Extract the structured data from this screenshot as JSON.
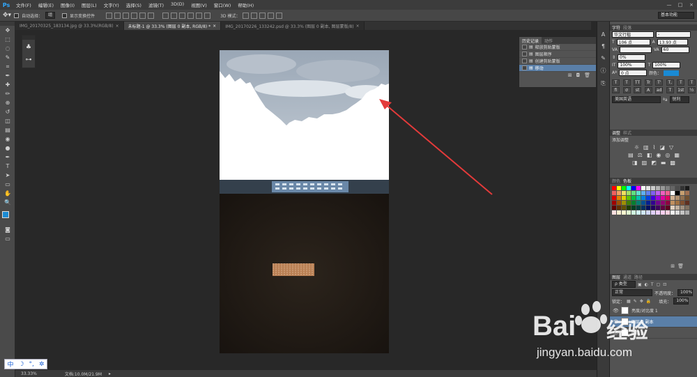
{
  "app": {
    "logo": "Ps"
  },
  "menu": [
    "文件(F)",
    "编辑(E)",
    "图像(I)",
    "图层(L)",
    "文字(Y)",
    "选择(S)",
    "滤镜(T)",
    "3D(D)",
    "视图(V)",
    "窗口(W)",
    "帮助(H)"
  ],
  "window_controls": [
    "—",
    "□",
    "×"
  ],
  "options": {
    "auto_select": "自动选择：",
    "auto_select_target": "组",
    "show_transform": "显示变换控件",
    "mode_3d": "3D 模式：",
    "workspace": "基本功能"
  },
  "tabs": [
    {
      "label": "IMG_20170325_183134.jpg @ 33.3%(RGB/8)",
      "active": false
    },
    {
      "label": "未标题-1 @ 33.3% (图层 0 副本, RGB/8) *",
      "active": true
    },
    {
      "label": "IMG_20170226_133242.psd @ 33.3% (图层 0 副本, 图层蒙版/8)",
      "active": false
    }
  ],
  "tools": [
    "移动",
    "矩形选框",
    "套索",
    "快速选择",
    "裁剪",
    "吸管",
    "污点修复",
    "画笔",
    "仿制图章",
    "历史记录画笔",
    "橡皮擦",
    "渐变",
    "模糊",
    "减淡",
    "钢笔",
    "文字",
    "路径选择",
    "矩形",
    "抓手",
    "缩放"
  ],
  "tool_icons": [
    "move-icon",
    "marquee-icon",
    "lasso-icon",
    "quick-select-icon",
    "crop-icon",
    "eyedropper-icon",
    "healing-icon",
    "brush-icon",
    "stamp-icon",
    "history-brush-icon",
    "eraser-icon",
    "gradient-icon",
    "blur-icon",
    "dodge-icon",
    "pen-icon",
    "type-icon",
    "path-select-icon",
    "rectangle-icon",
    "hand-icon",
    "zoom-icon"
  ],
  "tool_glyphs": [
    "✥",
    "⬚",
    "◌",
    "✎",
    "⌗",
    "✒",
    "✚",
    "✏",
    "⊕",
    "↺",
    "◫",
    "▤",
    "◉",
    "●",
    "✒",
    "T",
    "➤",
    "▭",
    "✋",
    "🔍"
  ],
  "colors": {
    "foreground": "#1a8ad4",
    "background": "#ffffff",
    "accent": "#5a7fa8",
    "arrow": "#e33a3a"
  },
  "history": {
    "tabs": [
      "历史记录",
      "动作"
    ],
    "items": [
      {
        "label": "释放剪贴蒙版",
        "active": false
      },
      {
        "label": "图层顺序",
        "active": false
      },
      {
        "label": "创建剪贴蒙版",
        "active": false
      },
      {
        "label": "移动",
        "active": true
      }
    ]
  },
  "character": {
    "tab": "字符",
    "tab2": "段落",
    "font_family": "华文行楷",
    "font_style": "-",
    "size": "106 点",
    "leading": "13.93 点",
    "tracking_label": "VA",
    "tracking": "60",
    "scale_pct": "0%",
    "vertical_scale": "100%",
    "horizontal_scale": "100%",
    "baseline": "0 点",
    "color_label": "颜色：",
    "style_buttons": [
      "T",
      "T",
      "TT",
      "Tr",
      "T'",
      "T,",
      "T",
      "T"
    ],
    "ligature_buttons": [
      "fi",
      "σ",
      "st",
      "A",
      "ad",
      "T",
      "1st",
      "½"
    ],
    "language": "美国英语",
    "aa_label": "ªa",
    "antialias": "锐利"
  },
  "adjustments": {
    "tabs": [
      "调整",
      "样式"
    ],
    "title": "添加调整"
  },
  "swatches": {
    "tabs": [
      "颜色",
      "色板"
    ]
  },
  "layers": {
    "tabs": [
      "图层",
      "通道",
      "路径"
    ],
    "kind": "ρ 类型",
    "blend": "正常",
    "opacity_label": "不透明度：",
    "opacity": "100%",
    "lock_label": "锁定：",
    "fill_label": "填充：",
    "fill": "100%",
    "items": [
      {
        "label": "亮度/对比度 1",
        "active": false
      },
      {
        "label": "图层 0 副本",
        "active": true
      },
      {
        "label": "图层 0",
        "active": false
      }
    ]
  },
  "status": {
    "zoom": "33.33%",
    "doc": "文档:10.0M/21.9M"
  },
  "ime": [
    "中",
    "☽",
    "°,",
    "✲"
  ],
  "watermark": {
    "brand": "Bai",
    "brand2": "经验",
    "url": "jingyan.baidu.com"
  }
}
